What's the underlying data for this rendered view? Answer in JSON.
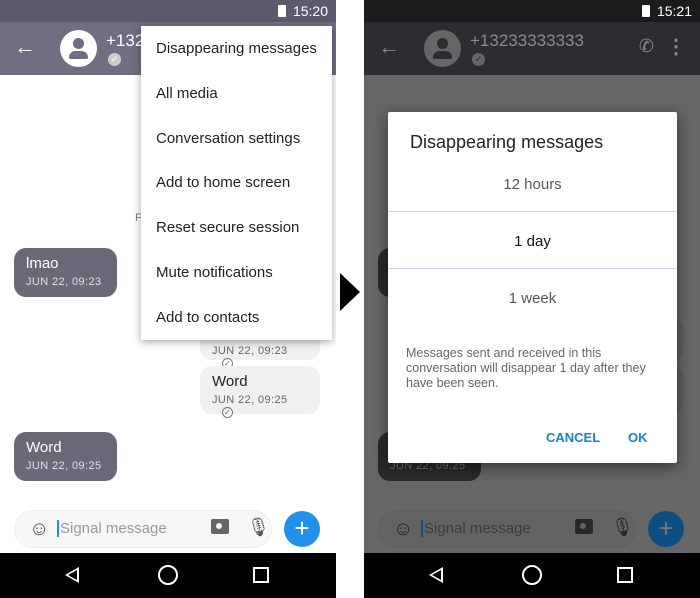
{
  "left": {
    "time": "15:20",
    "contact": "+13233333333",
    "menu": [
      "Disappearing messages",
      "All media",
      "Conversation settings",
      "Add to home screen",
      "Reset secure session",
      "Mute notifications",
      "Add to contacts"
    ],
    "date_header": "FRI, JUN 22",
    "messages": [
      {
        "dir": "received",
        "text": "lmao",
        "ts": "JUN 22, 09:23"
      },
      {
        "dir": "sent",
        "text": "",
        "ts": "JUN 22, 09:23"
      },
      {
        "dir": "sent",
        "text": "Word",
        "ts": "JUN 22, 09:25"
      },
      {
        "dir": "received",
        "text": "Word",
        "ts": "JUN 22, 09:25"
      }
    ],
    "composer_placeholder": "Signal message"
  },
  "right": {
    "time": "15:21",
    "contact": "+13233333333",
    "dialog": {
      "title": "Disappearing messages",
      "options": [
        "12 hours",
        "1 day",
        "1 week"
      ],
      "selected": "1 day",
      "description": "Messages sent and received in this conversation will disappear 1 day after they have been seen.",
      "cancel": "CANCEL",
      "ok": "OK"
    },
    "bg_ts": "JUN 22, 09:25",
    "composer_placeholder": "Signal message"
  },
  "colors": {
    "accent": "#2090ea",
    "toolbar": "#716d82",
    "received_bubble": "#6c6878",
    "dialog_button": "#1a7fd1"
  },
  "icons": [
    "back-arrow-icon",
    "avatar-icon",
    "verified-icon",
    "secure-call-icon",
    "more-vert-icon",
    "emoji-icon",
    "camera-icon",
    "mic-icon",
    "plus-icon",
    "nav-back-icon",
    "nav-home-icon",
    "nav-recents-icon",
    "check-icon"
  ]
}
